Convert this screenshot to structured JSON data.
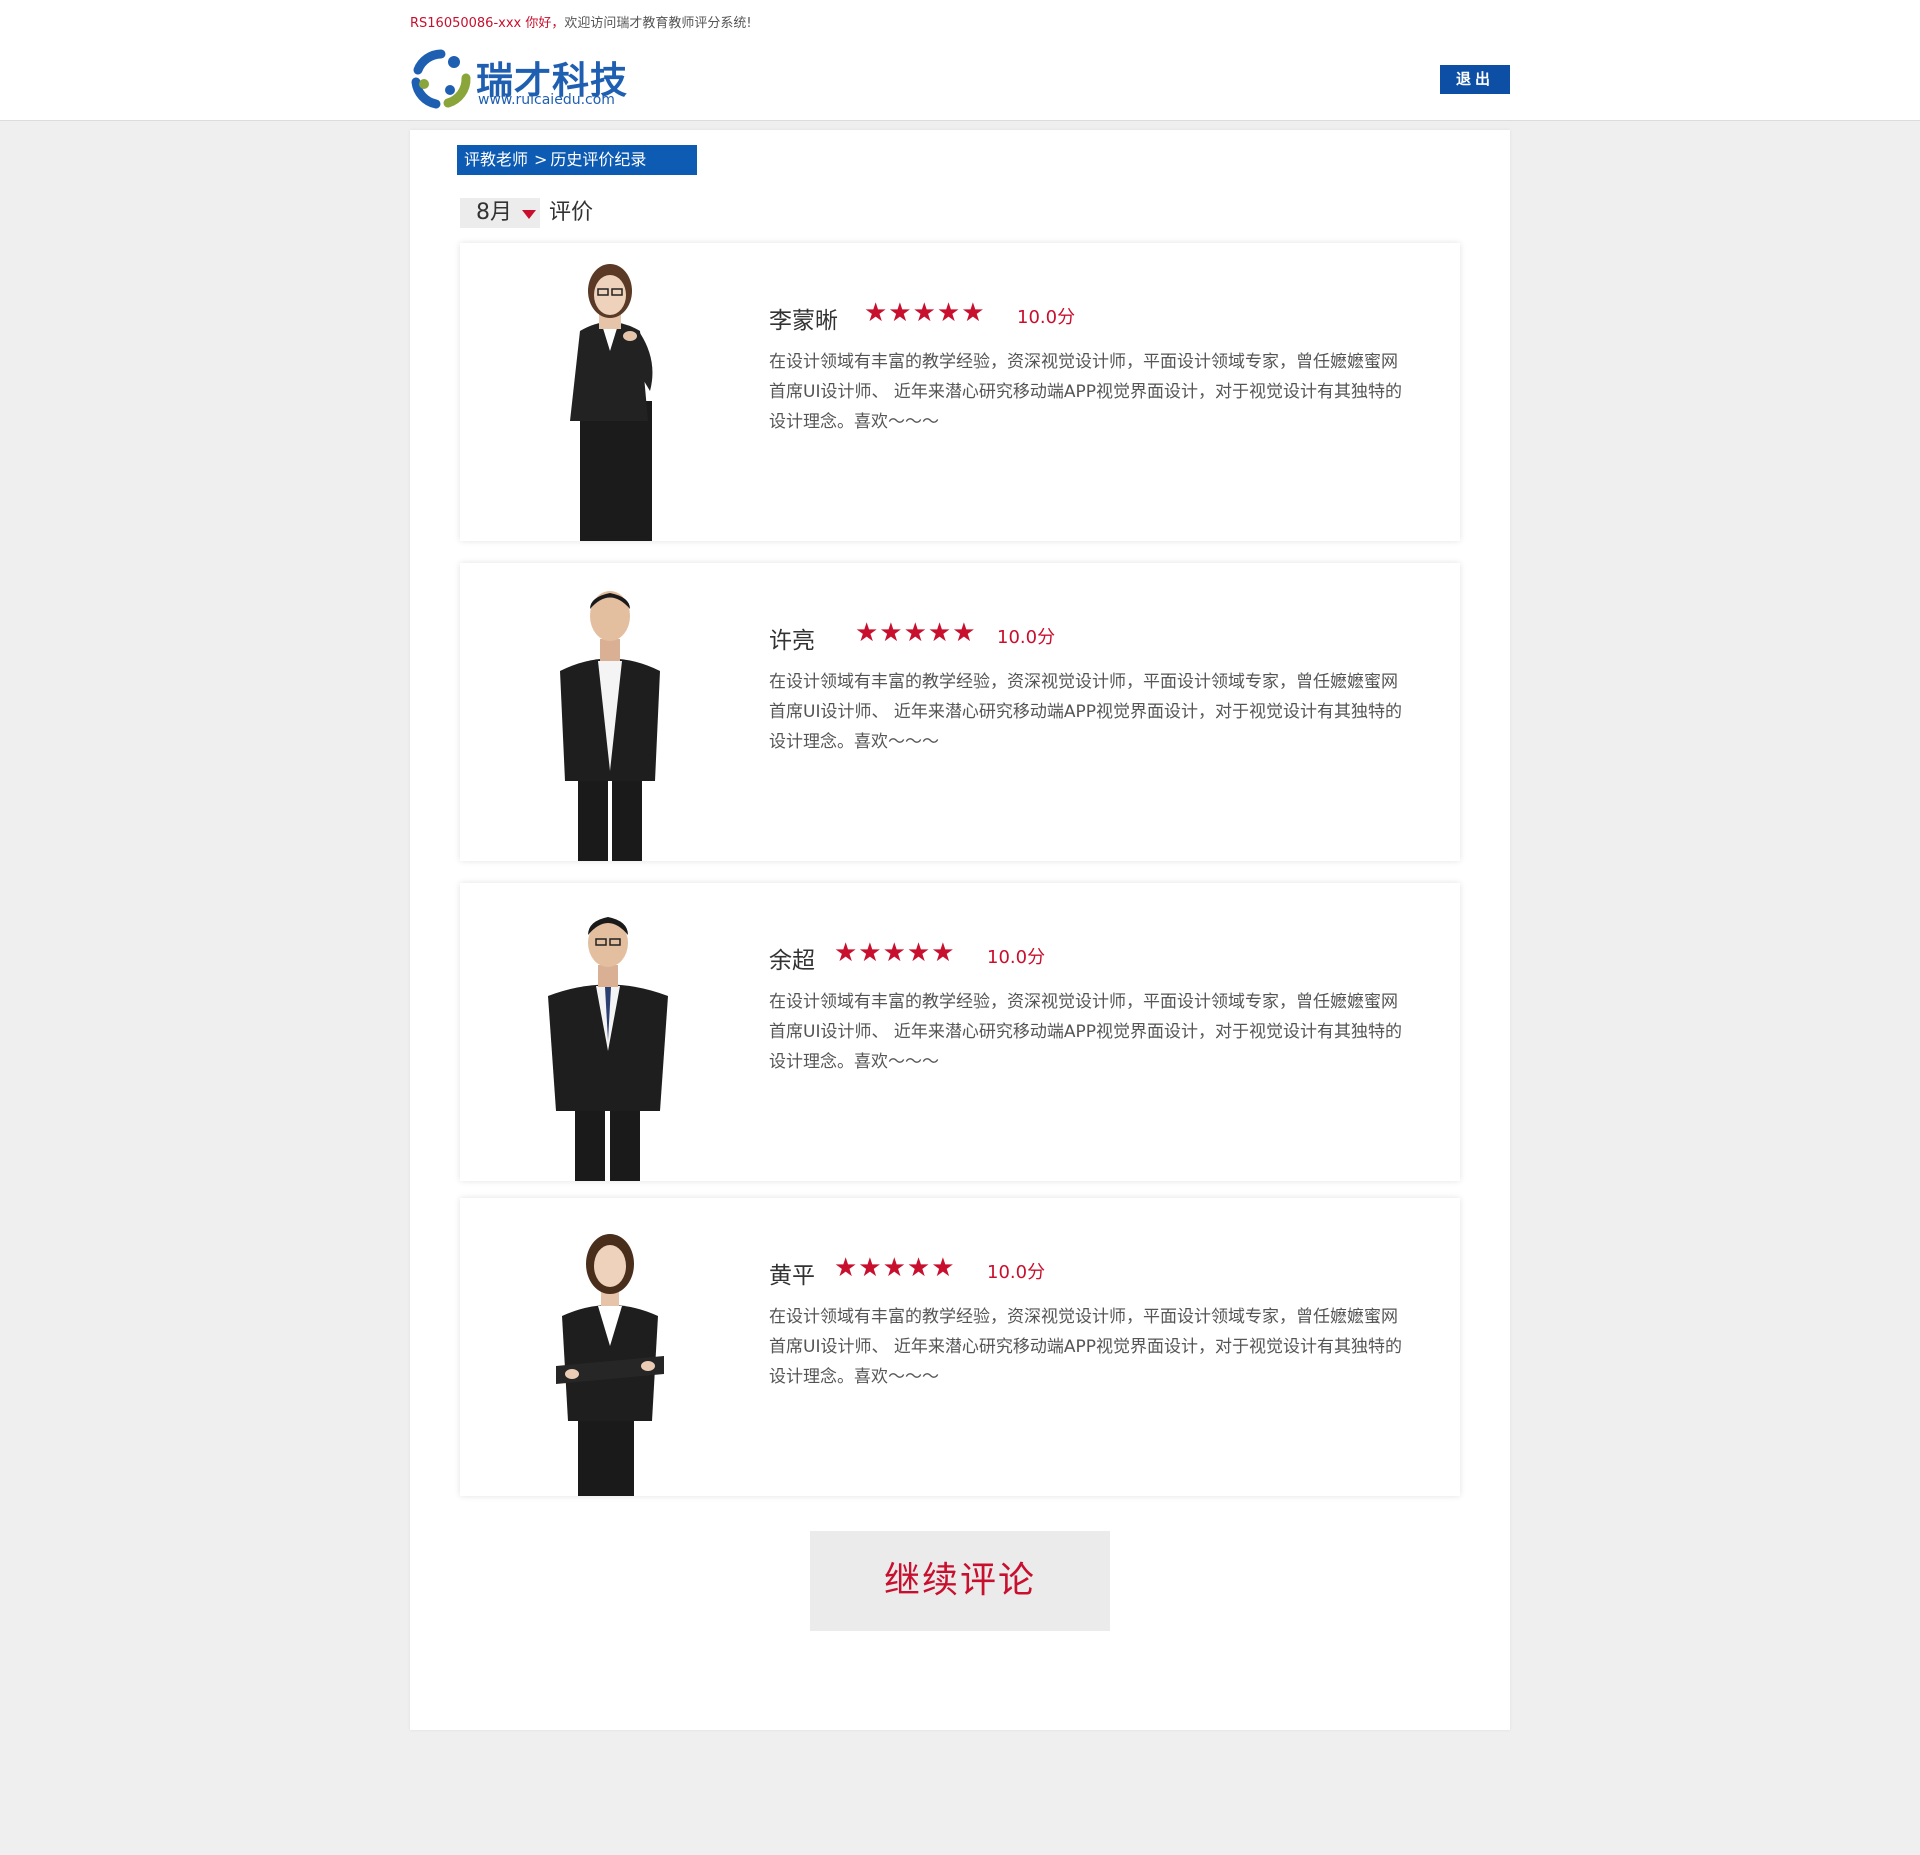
{
  "header": {
    "user_id": "RS16050086-xxx",
    "hello": "你好，",
    "welcome": "欢迎访问瑞才教育教师评分系统!",
    "logo_title": "瑞才科技",
    "logo_url": "www.ruicaiedu.com",
    "logout_label": "退出"
  },
  "breadcrumb": {
    "root": "评教老师",
    "separator": ">",
    "current": "历史评价纪录"
  },
  "filter": {
    "month": "8月",
    "suffix": "评价"
  },
  "teachers": [
    {
      "name": "李蒙晰",
      "stars": "★★★★★",
      "rating": 5,
      "score": "10.0分",
      "description": "在设计领域有丰富的教学经验，资深视觉设计师，平面设计领域专家，曾任嬷嬷蜜网首席UI设计师、 近年来潜心研究移动端APP视觉界面设计，对于视觉设计有其独特的设计理念。喜欢～～～"
    },
    {
      "name": "许亮",
      "stars": "★★★★★",
      "rating": 5,
      "score": "10.0分",
      "description": "在设计领域有丰富的教学经验，资深视觉设计师，平面设计领域专家，曾任嬷嬷蜜网首席UI设计师、 近年来潜心研究移动端APP视觉界面设计，对于视觉设计有其独特的设计理念。喜欢～～～"
    },
    {
      "name": "余超",
      "stars": "★★★★★",
      "rating": 5,
      "score": "10.0分",
      "description": "在设计领域有丰富的教学经验，资深视觉设计师，平面设计领域专家，曾任嬷嬷蜜网首席UI设计师、 近年来潜心研究移动端APP视觉界面设计，对于视觉设计有其独特的设计理念。喜欢～～～"
    },
    {
      "name": "黄平",
      "stars": "★★★★★",
      "rating": 5,
      "score": "10.0分",
      "description": "在设计领域有丰富的教学经验，资深视觉设计师，平面设计领域专家，曾任嬷嬷蜜网首席UI设计师、 近年来潜心研究移动端APP视觉界面设计，对于视觉设计有其独特的设计理念。喜欢～～～"
    }
  ],
  "continue_label": "继续评论",
  "colors": {
    "brand_blue": "#0d5bb3",
    "accent_red": "#c8102e",
    "page_bg": "#efefef"
  }
}
